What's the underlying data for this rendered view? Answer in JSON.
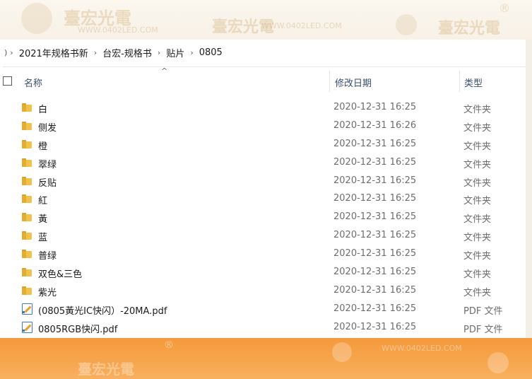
{
  "breadcrumb": {
    "items": [
      "2021年规格书新",
      "台宏-规格书",
      "贴片",
      "0805"
    ],
    "separator": "›"
  },
  "columns": {
    "name": "名称",
    "date": "修改日期",
    "type": "类型"
  },
  "files": [
    {
      "name": "白",
      "date": "2020-12-31 16:25",
      "type": "文件夹",
      "icon": "folder-icon"
    },
    {
      "name": "侧发",
      "date": "2020-12-31 16:26",
      "type": "文件夹",
      "icon": "folder-icon"
    },
    {
      "name": "橙",
      "date": "2020-12-31 16:25",
      "type": "文件夹",
      "icon": "folder-icon"
    },
    {
      "name": "翠绿",
      "date": "2020-12-31 16:25",
      "type": "文件夹",
      "icon": "folder-icon"
    },
    {
      "name": "反贴",
      "date": "2020-12-31 16:25",
      "type": "文件夹",
      "icon": "folder-icon"
    },
    {
      "name": "紅",
      "date": "2020-12-31 16:25",
      "type": "文件夹",
      "icon": "folder-icon"
    },
    {
      "name": "黃",
      "date": "2020-12-31 16:25",
      "type": "文件夹",
      "icon": "folder-icon"
    },
    {
      "name": "蓝",
      "date": "2020-12-31 16:25",
      "type": "文件夹",
      "icon": "folder-icon"
    },
    {
      "name": "普绿",
      "date": "2020-12-31 16:25",
      "type": "文件夹",
      "icon": "folder-icon"
    },
    {
      "name": "双色&三色",
      "date": "2020-12-31 16:25",
      "type": "文件夹",
      "icon": "folder-icon"
    },
    {
      "name": "紫光",
      "date": "2020-12-31 16:25",
      "type": "文件夹",
      "icon": "folder-icon"
    },
    {
      "name": "(0805黃光IC快闪）-20MA.pdf",
      "date": "2020-12-31 16:25",
      "type": "PDF 文件",
      "icon": "pdf-icon"
    },
    {
      "name": "0805RGB快闪.pdf",
      "date": "2020-12-31 16:25",
      "type": "PDF 文件",
      "icon": "pdf-icon"
    }
  ],
  "watermark": {
    "brand": "臺宏光電",
    "url": "WWW.0402LED.COM"
  },
  "colors": {
    "folder": "#f0c14b",
    "bottom_band": "#f59a3c",
    "header_text": "#3a4f6a"
  }
}
